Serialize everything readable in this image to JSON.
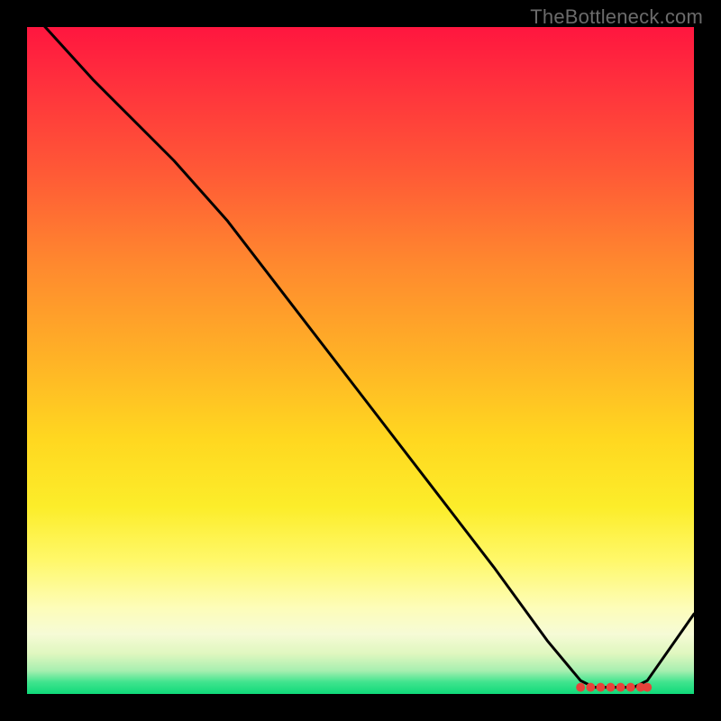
{
  "watermark": "TheBottleneck.com",
  "chart_data": {
    "type": "line",
    "title": "",
    "xlabel": "",
    "ylabel": "",
    "xlim": [
      0,
      100
    ],
    "ylim": [
      0,
      100
    ],
    "x": [
      0,
      10,
      22,
      30,
      40,
      50,
      60,
      70,
      78,
      83,
      85,
      87,
      89,
      91,
      93,
      100
    ],
    "values": [
      103,
      92,
      80,
      71,
      58,
      45,
      32,
      19,
      8,
      2,
      1,
      1,
      1,
      1,
      2,
      12
    ],
    "optimum_markers_x": [
      83,
      84.5,
      86,
      87.5,
      89,
      90.5,
      92,
      93
    ],
    "marker_color": "#e7423a",
    "line_color": "#000000"
  }
}
